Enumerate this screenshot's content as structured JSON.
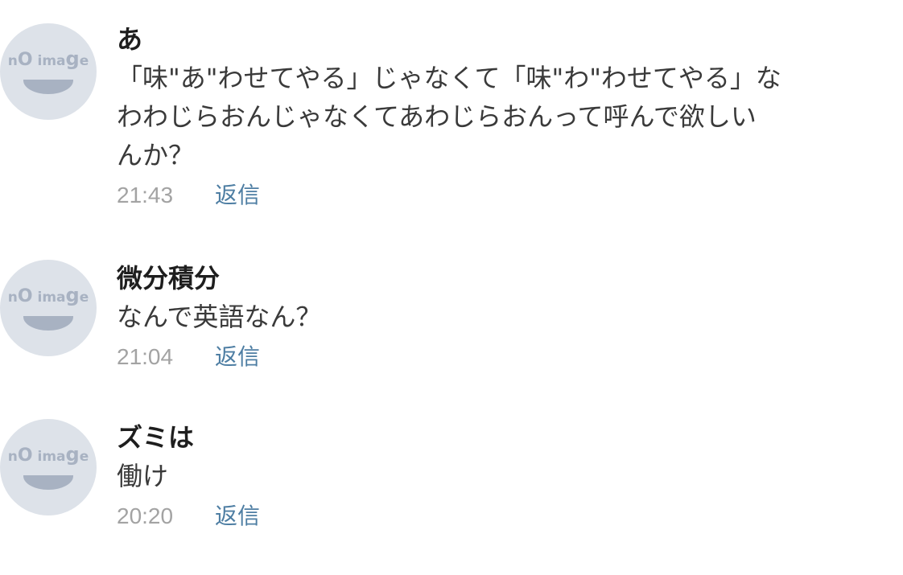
{
  "avatar": {
    "placeholder_text_parts": [
      "n",
      "O",
      " ima",
      "g",
      "e"
    ]
  },
  "comments": [
    {
      "author": "あ",
      "body": "「味\"あ\"わせてやる」じゃなくて「味\"わ\"わせてやる」な\nわわじらおんじゃなくてあわじらおんって呼んで欲しい\nんか？",
      "time": "21:43",
      "reply_label": "返信"
    },
    {
      "author": "微分積分",
      "body": "なんで英語なん？",
      "time": "21:04",
      "reply_label": "返信"
    },
    {
      "author": "ズミは",
      "body": "働け",
      "time": "20:20",
      "reply_label": "返信"
    }
  ],
  "colors": {
    "author": "#1e1e1e",
    "body": "#3a3a3a",
    "time": "#a3a3a3",
    "reply": "#4e7ea3",
    "avatar_bg": "#dde2e9",
    "avatar_fg": "#a8b2c2"
  }
}
